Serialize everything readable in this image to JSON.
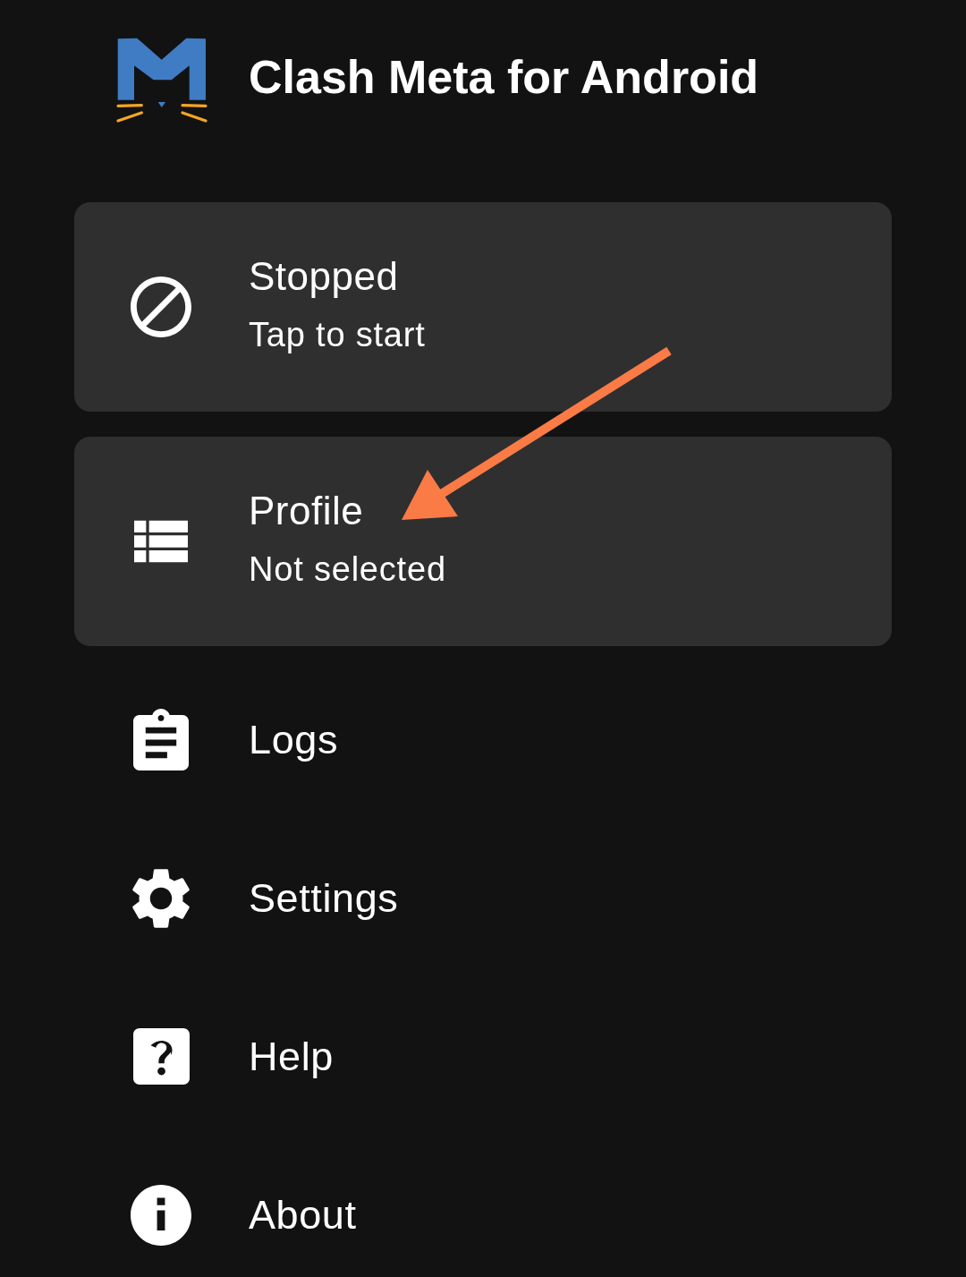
{
  "header": {
    "title": "Clash Meta for Android"
  },
  "cards": [
    {
      "title": "Stopped",
      "subtitle": "Tap to start"
    },
    {
      "title": "Profile",
      "subtitle": "Not selected"
    }
  ],
  "menu": [
    {
      "label": "Logs"
    },
    {
      "label": "Settings"
    },
    {
      "label": "Help"
    },
    {
      "label": "About"
    }
  ],
  "annotations": [
    {
      "kind": "arrow"
    }
  ]
}
